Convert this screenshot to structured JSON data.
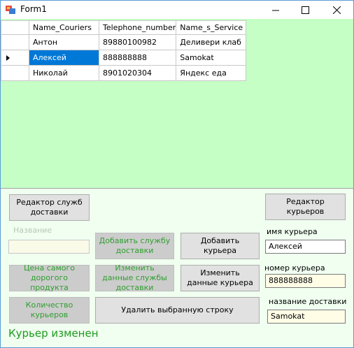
{
  "window": {
    "title": "Form1",
    "minimize_glyph": "—",
    "maximize_glyph": "☐",
    "close_glyph": "✕"
  },
  "grid": {
    "columns": [
      "Name_Couriers",
      "Telephone_number",
      "Name_s_Service"
    ],
    "rows": [
      [
        "Антон",
        "89880100982",
        "Деливери клаб"
      ],
      [
        "Алексей",
        "888888888",
        "Samokat"
      ],
      [
        "Николай",
        "8901020304",
        "Яндекс еда"
      ]
    ],
    "selected_row": 1
  },
  "buttons": {
    "service_editor": "Редактор служб доставки",
    "courier_editor": "Редактор курьеров",
    "add_service": "Добавить службу доставки",
    "add_courier": "Добавить курьера",
    "expensive_product": "Цена самого дорогого продукта",
    "edit_service": "Изменить данные службы доставки",
    "edit_courier": "Изменить данные курьера",
    "courier_count": "Количество курьеров",
    "delete_row": "Удалить выбранную строку"
  },
  "labels": {
    "name": "Название",
    "courier_name": "имя курьера",
    "courier_number": "номер курьера",
    "delivery_name": "название доставки"
  },
  "fields": {
    "name_value": "",
    "courier_name_value": "Алексей",
    "courier_number_value": "888888888",
    "delivery_name_value": "Samokat"
  },
  "status": "Курьер изменен",
  "colors": {
    "grid_background": "#c6ffc6",
    "form_background": "#f0fff0",
    "selection": "#0078d7",
    "disabled_text": "#2f9e2f",
    "status_text": "#1e9a1e"
  }
}
